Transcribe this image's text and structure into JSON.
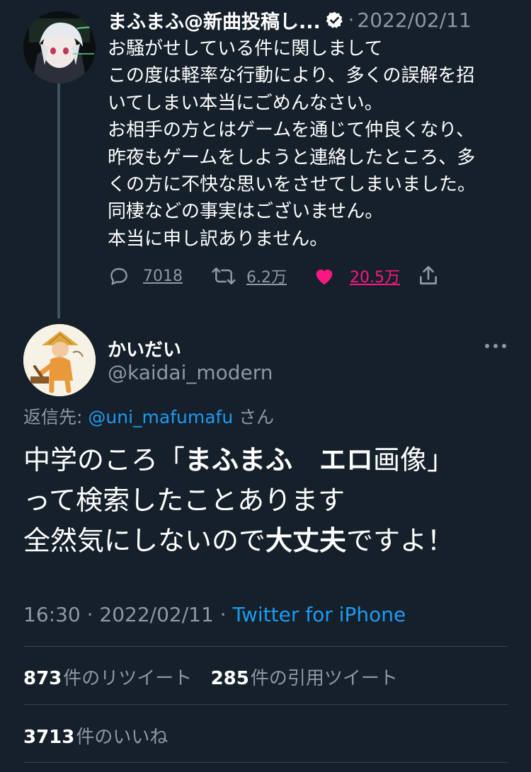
{
  "parent_tweet": {
    "display_name": "まふまふ@新曲投稿し...",
    "separator": "·",
    "date": "2022/02/11",
    "body_lines": [
      "お騒がせしている件に関しまして",
      "この度は軽率な行動により、多くの誤解を招",
      "いてしまい本当にごめんなさい。",
      "お相手の方とはゲームを通じて仲良くなり、",
      "昨夜もゲームをしようと連絡したところ、多",
      "くの方に不快な思いをさせてしまいました。",
      "同棲などの事実はございません。",
      "本当に申し訳ありません。"
    ],
    "reply_count": "7018",
    "retweet_count": "6.2万",
    "like_count": "20.5万",
    "icons": [
      "verified-badge-icon",
      "reply-icon",
      "retweet-icon",
      "heart-icon",
      "share-icon"
    ]
  },
  "reply_tweet": {
    "display_name": "かいだい",
    "handle": "@kaidai_modern",
    "replying_prefix": "返信先:",
    "replying_mention": "@uni_mafumafu",
    "replying_suffix": "さん",
    "body": {
      "line1_a": "中学のころ「",
      "line1_bold": "まふまふ　エロ",
      "line1_b": "画像」",
      "line2": "って検索したことあります",
      "line3_a": "全然気にしないので",
      "line3_bold": "大丈夫",
      "line3_b": "ですよ！"
    },
    "time": "16:30",
    "date": "2022/02/11",
    "separator": "·",
    "source": "Twitter for iPhone"
  },
  "stats": {
    "retweets": "873",
    "retweets_label": "件のリツイート",
    "quotes": "285",
    "quotes_label": "件の引用ツイート",
    "likes": "3713",
    "likes_label": "件のいいね"
  },
  "colors": {
    "background": "#15202b",
    "secondary_text": "#8b98a5",
    "accent_blue": "#1d9bf0",
    "like_pink": "#f91880",
    "divider": "#38444d"
  }
}
